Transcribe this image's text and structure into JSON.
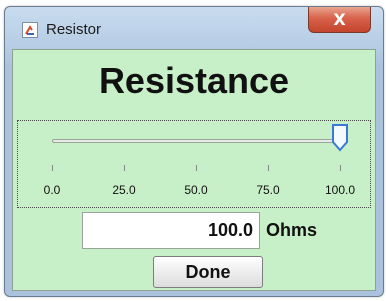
{
  "window": {
    "title": "Resistor",
    "close_label": "X"
  },
  "main": {
    "heading": "Resistance",
    "slider": {
      "value": 100.0,
      "min": 0.0,
      "max": 100.0,
      "ticks": [
        "0.0",
        "25.0",
        "50.0",
        "75.0",
        "100.0"
      ]
    },
    "value_text": "100.0",
    "units": "Ohms",
    "done_label": "Done"
  }
}
